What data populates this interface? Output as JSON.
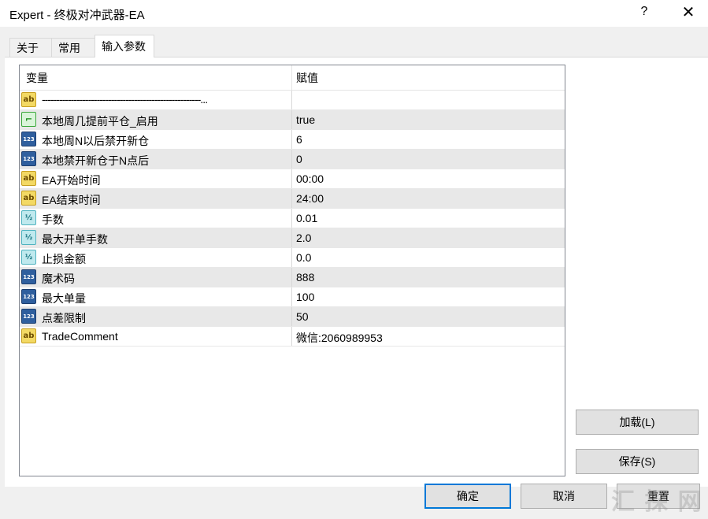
{
  "window": {
    "title": "Expert - 终极对冲武器-EA",
    "help_label": "?",
    "close_label": "✕"
  },
  "tabs": [
    {
      "label": "关于"
    },
    {
      "label": "常用"
    },
    {
      "label": "输入参数",
      "active": true
    }
  ],
  "grid": {
    "columns": [
      "变量",
      "赋值"
    ],
    "rows": [
      {
        "icon": "ab-string-icon",
        "glyph": "ab",
        "name": "-------------------------------------------------------...",
        "value": ""
      },
      {
        "icon": "bool-icon",
        "glyph": "⌐",
        "name": "本地周几提前平仓_启用",
        "value": "true"
      },
      {
        "icon": "int-icon",
        "glyph": "123",
        "name": "本地周N以后禁开新仓",
        "value": "6"
      },
      {
        "icon": "int-icon",
        "glyph": "123",
        "name": "本地禁开新仓于N点后",
        "value": "0"
      },
      {
        "icon": "ab-string-icon",
        "glyph": "ab",
        "name": "EA开始时间",
        "value": "00:00"
      },
      {
        "icon": "ab-string-icon",
        "glyph": "ab",
        "name": "EA结束时间",
        "value": "24:00"
      },
      {
        "icon": "double-icon",
        "glyph": "½",
        "name": "手数",
        "value": "0.01"
      },
      {
        "icon": "double-icon",
        "glyph": "½",
        "name": "最大开单手数",
        "value": "2.0"
      },
      {
        "icon": "double-icon",
        "glyph": "½",
        "name": "止损金额",
        "value": "0.0"
      },
      {
        "icon": "int-icon",
        "glyph": "123",
        "name": "魔术码",
        "value": "888"
      },
      {
        "icon": "int-icon",
        "glyph": "123",
        "name": "最大单量",
        "value": "100"
      },
      {
        "icon": "int-icon",
        "glyph": "123",
        "name": "点差限制",
        "value": "50"
      },
      {
        "icon": "ab-string-icon",
        "glyph": "ab",
        "name": "TradeComment",
        "value": "微信:2060989953"
      }
    ]
  },
  "buttons": {
    "load": "加载(L)",
    "save": "保存(S)",
    "ok": "确定",
    "cancel": "取消",
    "reset": "重置"
  },
  "watermark": "汇 探 网"
}
